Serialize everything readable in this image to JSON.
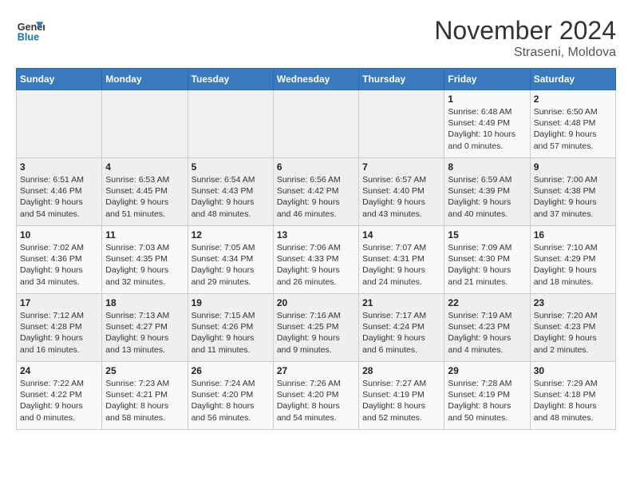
{
  "header": {
    "logo_line1": "General",
    "logo_line2": "Blue",
    "month": "November 2024",
    "location": "Straseni, Moldova"
  },
  "weekdays": [
    "Sunday",
    "Monday",
    "Tuesday",
    "Wednesday",
    "Thursday",
    "Friday",
    "Saturday"
  ],
  "weeks": [
    [
      {
        "day": "",
        "detail": ""
      },
      {
        "day": "",
        "detail": ""
      },
      {
        "day": "",
        "detail": ""
      },
      {
        "day": "",
        "detail": ""
      },
      {
        "day": "",
        "detail": ""
      },
      {
        "day": "1",
        "detail": "Sunrise: 6:48 AM\nSunset: 4:49 PM\nDaylight: 10 hours\nand 0 minutes."
      },
      {
        "day": "2",
        "detail": "Sunrise: 6:50 AM\nSunset: 4:48 PM\nDaylight: 9 hours\nand 57 minutes."
      }
    ],
    [
      {
        "day": "3",
        "detail": "Sunrise: 6:51 AM\nSunset: 4:46 PM\nDaylight: 9 hours\nand 54 minutes."
      },
      {
        "day": "4",
        "detail": "Sunrise: 6:53 AM\nSunset: 4:45 PM\nDaylight: 9 hours\nand 51 minutes."
      },
      {
        "day": "5",
        "detail": "Sunrise: 6:54 AM\nSunset: 4:43 PM\nDaylight: 9 hours\nand 48 minutes."
      },
      {
        "day": "6",
        "detail": "Sunrise: 6:56 AM\nSunset: 4:42 PM\nDaylight: 9 hours\nand 46 minutes."
      },
      {
        "day": "7",
        "detail": "Sunrise: 6:57 AM\nSunset: 4:40 PM\nDaylight: 9 hours\nand 43 minutes."
      },
      {
        "day": "8",
        "detail": "Sunrise: 6:59 AM\nSunset: 4:39 PM\nDaylight: 9 hours\nand 40 minutes."
      },
      {
        "day": "9",
        "detail": "Sunrise: 7:00 AM\nSunset: 4:38 PM\nDaylight: 9 hours\nand 37 minutes."
      }
    ],
    [
      {
        "day": "10",
        "detail": "Sunrise: 7:02 AM\nSunset: 4:36 PM\nDaylight: 9 hours\nand 34 minutes."
      },
      {
        "day": "11",
        "detail": "Sunrise: 7:03 AM\nSunset: 4:35 PM\nDaylight: 9 hours\nand 32 minutes."
      },
      {
        "day": "12",
        "detail": "Sunrise: 7:05 AM\nSunset: 4:34 PM\nDaylight: 9 hours\nand 29 minutes."
      },
      {
        "day": "13",
        "detail": "Sunrise: 7:06 AM\nSunset: 4:33 PM\nDaylight: 9 hours\nand 26 minutes."
      },
      {
        "day": "14",
        "detail": "Sunrise: 7:07 AM\nSunset: 4:31 PM\nDaylight: 9 hours\nand 24 minutes."
      },
      {
        "day": "15",
        "detail": "Sunrise: 7:09 AM\nSunset: 4:30 PM\nDaylight: 9 hours\nand 21 minutes."
      },
      {
        "day": "16",
        "detail": "Sunrise: 7:10 AM\nSunset: 4:29 PM\nDaylight: 9 hours\nand 18 minutes."
      }
    ],
    [
      {
        "day": "17",
        "detail": "Sunrise: 7:12 AM\nSunset: 4:28 PM\nDaylight: 9 hours\nand 16 minutes."
      },
      {
        "day": "18",
        "detail": "Sunrise: 7:13 AM\nSunset: 4:27 PM\nDaylight: 9 hours\nand 13 minutes."
      },
      {
        "day": "19",
        "detail": "Sunrise: 7:15 AM\nSunset: 4:26 PM\nDaylight: 9 hours\nand 11 minutes."
      },
      {
        "day": "20",
        "detail": "Sunrise: 7:16 AM\nSunset: 4:25 PM\nDaylight: 9 hours\nand 9 minutes."
      },
      {
        "day": "21",
        "detail": "Sunrise: 7:17 AM\nSunset: 4:24 PM\nDaylight: 9 hours\nand 6 minutes."
      },
      {
        "day": "22",
        "detail": "Sunrise: 7:19 AM\nSunset: 4:23 PM\nDaylight: 9 hours\nand 4 minutes."
      },
      {
        "day": "23",
        "detail": "Sunrise: 7:20 AM\nSunset: 4:23 PM\nDaylight: 9 hours\nand 2 minutes."
      }
    ],
    [
      {
        "day": "24",
        "detail": "Sunrise: 7:22 AM\nSunset: 4:22 PM\nDaylight: 9 hours\nand 0 minutes."
      },
      {
        "day": "25",
        "detail": "Sunrise: 7:23 AM\nSunset: 4:21 PM\nDaylight: 8 hours\nand 58 minutes."
      },
      {
        "day": "26",
        "detail": "Sunrise: 7:24 AM\nSunset: 4:20 PM\nDaylight: 8 hours\nand 56 minutes."
      },
      {
        "day": "27",
        "detail": "Sunrise: 7:26 AM\nSunset: 4:20 PM\nDaylight: 8 hours\nand 54 minutes."
      },
      {
        "day": "28",
        "detail": "Sunrise: 7:27 AM\nSunset: 4:19 PM\nDaylight: 8 hours\nand 52 minutes."
      },
      {
        "day": "29",
        "detail": "Sunrise: 7:28 AM\nSunset: 4:19 PM\nDaylight: 8 hours\nand 50 minutes."
      },
      {
        "day": "30",
        "detail": "Sunrise: 7:29 AM\nSunset: 4:18 PM\nDaylight: 8 hours\nand 48 minutes."
      }
    ]
  ]
}
